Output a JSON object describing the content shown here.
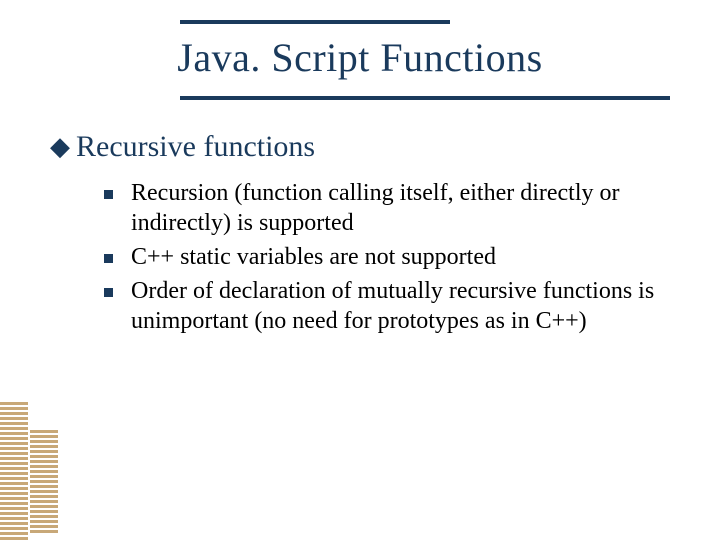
{
  "slide": {
    "title": "Java. Script Functions",
    "level1": {
      "marker": "◆",
      "text": "Recursive functions"
    },
    "level2": [
      {
        "text": "Recursion (function calling itself, either directly or indirectly) is supported"
      },
      {
        "text": "C++ static variables are not supported"
      },
      {
        "text": "Order of declaration of mutually recursive functions is unimportant (no need for prototypes as in C++)"
      }
    ]
  },
  "colors": {
    "accent": "#1a3a5c",
    "stripe": "#c8a878"
  }
}
